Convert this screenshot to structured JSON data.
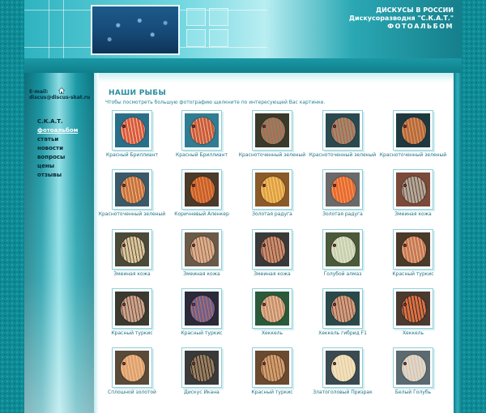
{
  "header": {
    "line1": "ДИСКУСЫ В РОССИИ",
    "line2": "Дискусоразводня \"С.К.А.Т.\"",
    "line3": "ФОТОАЛЬБОМ"
  },
  "sidebar": {
    "email_label": "E-mail:",
    "email": "discus@discus-skat.ru",
    "home_icon": "home-icon",
    "nav": [
      {
        "label": "С.К.А.Т.",
        "active": false
      },
      {
        "label": "фотоальбом",
        "active": true
      },
      {
        "label": "статьи",
        "active": false
      },
      {
        "label": "новости",
        "active": false
      },
      {
        "label": "вопросы",
        "active": false
      },
      {
        "label": "цены",
        "active": false
      },
      {
        "label": "отзывы",
        "active": false
      }
    ]
  },
  "main": {
    "title": "НАШИ РЫБЫ",
    "subtitle": "Чтобы посмотреть большую фотографию щелкните по интересующей Вас картинке."
  },
  "fish": [
    {
      "caption": "Красный Бриллиант",
      "bg": "#2a6f8a",
      "body": "#d9583a",
      "stripe": "#f2c7a8"
    },
    {
      "caption": "Красный Бриллиант",
      "bg": "#2f7d92",
      "body": "#c95a3a",
      "stripe": "#f0b890"
    },
    {
      "caption": "Красноточенный зеленый",
      "bg": "#3a3a2a",
      "body": "#8c7a60",
      "stripe": "#d46a4a"
    },
    {
      "caption": "Красноточенный зеленый",
      "bg": "#2a4a50",
      "body": "#9a8c70",
      "stripe": "#c8503a"
    },
    {
      "caption": "Красноточенный зеленый",
      "bg": "#1e3a40",
      "body": "#b86a3a",
      "stripe": "#e0a070"
    },
    {
      "caption": "Красноточенный зеленый",
      "bg": "#3a5a6a",
      "body": "#c87040",
      "stripe": "#f0c080"
    },
    {
      "caption": "Коричневый Аленкер",
      "bg": "#4a3a2a",
      "body": "#c8602a",
      "stripe": "#f09050"
    },
    {
      "caption": "Золотая радуга",
      "bg": "#8a5a2a",
      "body": "#e0a040",
      "stripe": "#f8d080"
    },
    {
      "caption": "Золотая радуга",
      "bg": "#6a6a6a",
      "body": "#e86a30",
      "stripe": "#f8a060"
    },
    {
      "caption": "Змеиная кожа",
      "bg": "#7a4a3a",
      "body": "#b8a898",
      "stripe": "#5a4a40"
    },
    {
      "caption": "Змеиная кожа",
      "bg": "#4a4a3a",
      "body": "#d8c8a0",
      "stripe": "#6a4a30"
    },
    {
      "caption": "Змеиная кожа",
      "bg": "#6a5a4a",
      "body": "#d8b090",
      "stripe": "#a06040"
    },
    {
      "caption": "Змеиная кожа",
      "bg": "#3a3a3a",
      "body": "#c89070",
      "stripe": "#7a3a2a"
    },
    {
      "caption": "Голубой алмаз",
      "bg": "#4a5a3a",
      "body": "#c8d0b0",
      "stripe": "#e8e8d0"
    },
    {
      "caption": "Красный туркис",
      "bg": "#4a3a2a",
      "body": "#c87850",
      "stripe": "#e8c0a0"
    },
    {
      "caption": "Красный туркис",
      "bg": "#3a3a30",
      "body": "#c8a890",
      "stripe": "#7a4030"
    },
    {
      "caption": "Красный туркис",
      "bg": "#2a2a3a",
      "body": "#6a6090",
      "stripe": "#d07050"
    },
    {
      "caption": "Хеккель",
      "bg": "#2a5a3a",
      "body": "#c89070",
      "stripe": "#f0d0a0"
    },
    {
      "caption": "Хеккель гибрид F1",
      "bg": "#2a4a4a",
      "body": "#d0a080",
      "stripe": "#8a4a3a"
    },
    {
      "caption": "Хеккель",
      "bg": "#4a3a30",
      "body": "#e07040",
      "stripe": "#2a2a2a"
    },
    {
      "caption": "Сплошной золотой",
      "bg": "#5a4a3a",
      "body": "#e0a070",
      "stripe": "#f0c890"
    },
    {
      "caption": "Дискус Икана",
      "bg": "#3a3a3a",
      "body": "#9a8060",
      "stripe": "#2a2020"
    },
    {
      "caption": "Красный туркис",
      "bg": "#6a4a30",
      "body": "#d0a070",
      "stripe": "#8a5030"
    },
    {
      "caption": "Златоголовый Призрак",
      "bg": "#3a4a50",
      "body": "#f0e0c0",
      "stripe": "#e8c890"
    },
    {
      "caption": "Белый Голубь",
      "bg": "#5a6a70",
      "body": "#d8d8d0",
      "stripe": "#e8b890"
    }
  ]
}
